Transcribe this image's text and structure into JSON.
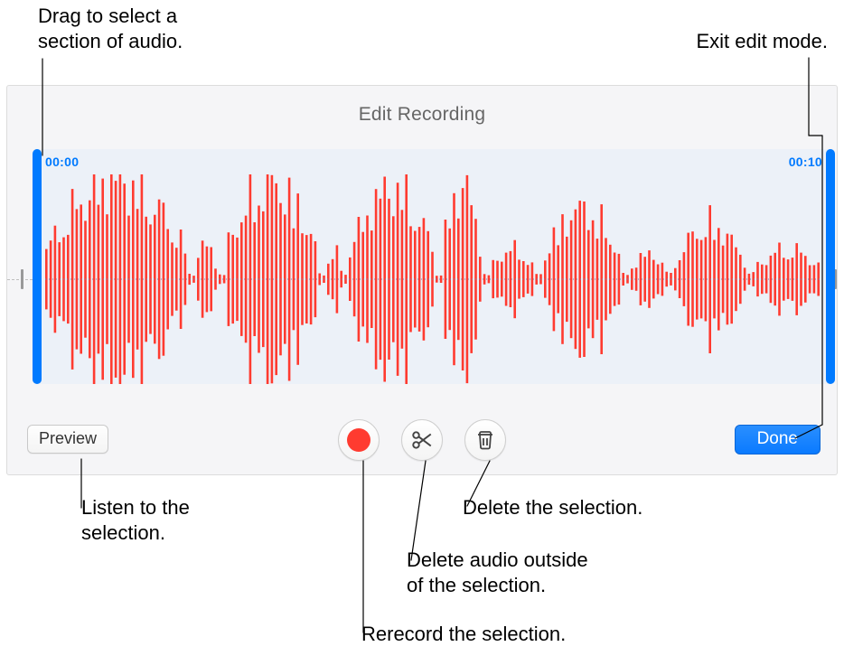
{
  "callouts": {
    "drag_select": "Drag to select a\nsection of audio.",
    "exit_edit": "Exit edit mode.",
    "preview": "Listen to the\nselection.",
    "delete_sel": "Delete the selection.",
    "trim": "Delete audio outside\nof the selection.",
    "rerecord": "Rerecord the selection."
  },
  "panel": {
    "title": "Edit Recording",
    "start_time": "00:00",
    "end_time": "00:10"
  },
  "toolbar": {
    "preview_label": "Preview",
    "done_label": "Done"
  },
  "waveform": {
    "bar_color": "#ff3b30",
    "bar_width": 2.6,
    "bar_gap": 2.2
  }
}
